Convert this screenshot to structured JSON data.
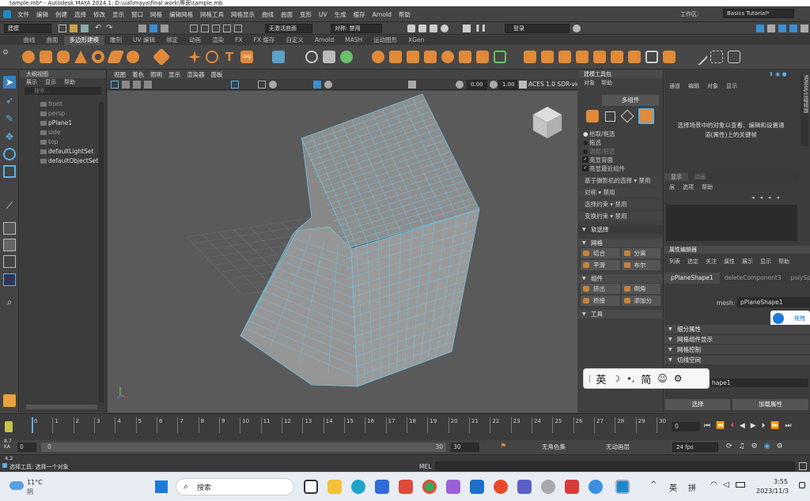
{
  "window": {
    "title": "tample.mb* - Autodesk MAYA 2024.1: D:\\ual\\maya\\final work\\等面\\tample.mb"
  },
  "menu": {
    "items": [
      "文件",
      "编辑",
      "创建",
      "选择",
      "修改",
      "显示",
      "窗口",
      "网格",
      "编辑网格",
      "网格工具",
      "网格显示",
      "曲线",
      "曲面",
      "变形",
      "UV",
      "生成",
      "缓存",
      "Arnold",
      "帮助"
    ],
    "workspace_label": "工作区:",
    "workspace_value": "Basics Tutorial*"
  },
  "status": {
    "mode": "建模",
    "live_surface": "无激活曲面",
    "symmetry": "对称: 禁用",
    "login": "登录"
  },
  "shelf_tabs": [
    "曲线",
    "曲面",
    "多边形建模",
    "雕刻",
    "UV 编辑",
    "绑定",
    "动画",
    "渲染",
    "FX",
    "FX 缓存",
    "自定义",
    "Arnold",
    "MASH",
    "运动图形",
    "XGen"
  ],
  "shelf_active": "多边形建模",
  "outliner": {
    "title": "大纲视图",
    "menu": [
      "展示",
      "显示",
      "帮助"
    ],
    "search_placeholder": "搜索...",
    "items": [
      {
        "label": "front",
        "visible": false
      },
      {
        "label": "persp",
        "visible": false
      },
      {
        "label": "pPlane1",
        "visible": true
      },
      {
        "label": "side",
        "visible": false
      },
      {
        "label": "top",
        "visible": false
      },
      {
        "label": "defaultLightSet",
        "visible": true
      },
      {
        "label": "defaultObjectSet",
        "visible": true
      }
    ]
  },
  "viewport": {
    "menu": [
      "视图",
      "着色",
      "照明",
      "显示",
      "渲染器",
      "面板"
    ],
    "value_a": "0.00",
    "value_b": "1.00",
    "color_space": "ACES 1.0 SDR-vide"
  },
  "modeling_toolkit": {
    "title": "建模工具包",
    "menu": [
      "对象",
      "帮助"
    ],
    "mode_button": "多组件",
    "radio_options": [
      "拾取/框选",
      "拖选",
      "调整/框选"
    ],
    "checkbox_options": [
      "亮显背面",
      "亮显最近组件"
    ],
    "camera_based": "基于摄影机的选择",
    "disabled": "禁用",
    "symmetry_label": "对称",
    "select_constraint": "选择约束",
    "transform_constraint": "变换约束",
    "soft_select": "软选择",
    "mesh_section": "网格",
    "mesh_buttons": [
      "结合",
      "分离",
      "平滑",
      "布尔"
    ],
    "component_section": "组件",
    "component_buttons": [
      "挤出",
      "倒角",
      "桥接",
      "添加分"
    ],
    "tools_section": "工具"
  },
  "channel_box": {
    "menu": [
      "通道",
      "编辑",
      "对象",
      "显示"
    ],
    "message": "选择场景中的对象以查看、编辑和设置通道(属性)上的关键帧",
    "layer_tabs": [
      "显示",
      "动画"
    ],
    "layer_menu": [
      "层",
      "选项",
      "帮助"
    ],
    "side_tab": "通道盒/层编辑器"
  },
  "attribute_editor": {
    "title": "属性编辑器",
    "menu": [
      "列表",
      "选定",
      "关注",
      "属性",
      "展示",
      "显示",
      "帮助"
    ],
    "tabs": [
      "pPlaneShape1",
      "deleteComponent3",
      "polySp"
    ],
    "mesh_label": "mesh:",
    "mesh_value": "pPlaneShape1",
    "sections": [
      "细分属性",
      "网格组件显示",
      "网格控制",
      "切线空间"
    ],
    "partial_field": "hape1",
    "select_button": "选择",
    "load_attr_button": "加载属性",
    "drag_tab": "拖拽"
  },
  "timeline": {
    "ticks": [
      "0",
      "1",
      "2",
      "3",
      "4",
      "5",
      "6",
      "7",
      "8",
      "9",
      "10",
      "11",
      "12",
      "13",
      "14",
      "15",
      "16",
      "17",
      "18",
      "19",
      "20",
      "21",
      "22",
      "23",
      "24",
      "25",
      "26",
      "27",
      "28",
      "29",
      "30"
    ],
    "current_frame": "0",
    "range_start": "0",
    "range_start2": "0",
    "range_end": "30",
    "range_end2": "30",
    "character_set": "无角色集",
    "anim_layer": "无动画层",
    "fps": "24 fps",
    "fps_readout_a": "8.7",
    "fps_readout_b": "KA",
    "fps_readout_c": "4.2"
  },
  "command_line": {
    "label": "MEL",
    "help": "选择工具: 选择一个对象"
  },
  "ime": {
    "lang": "英",
    "mode": "简"
  },
  "taskbar": {
    "temperature": "11°C",
    "weather": "阴",
    "search_placeholder": "搜索",
    "ime_lang": "英",
    "ime_mode": "拼",
    "time": "3:55",
    "date": "2023/11/3"
  }
}
